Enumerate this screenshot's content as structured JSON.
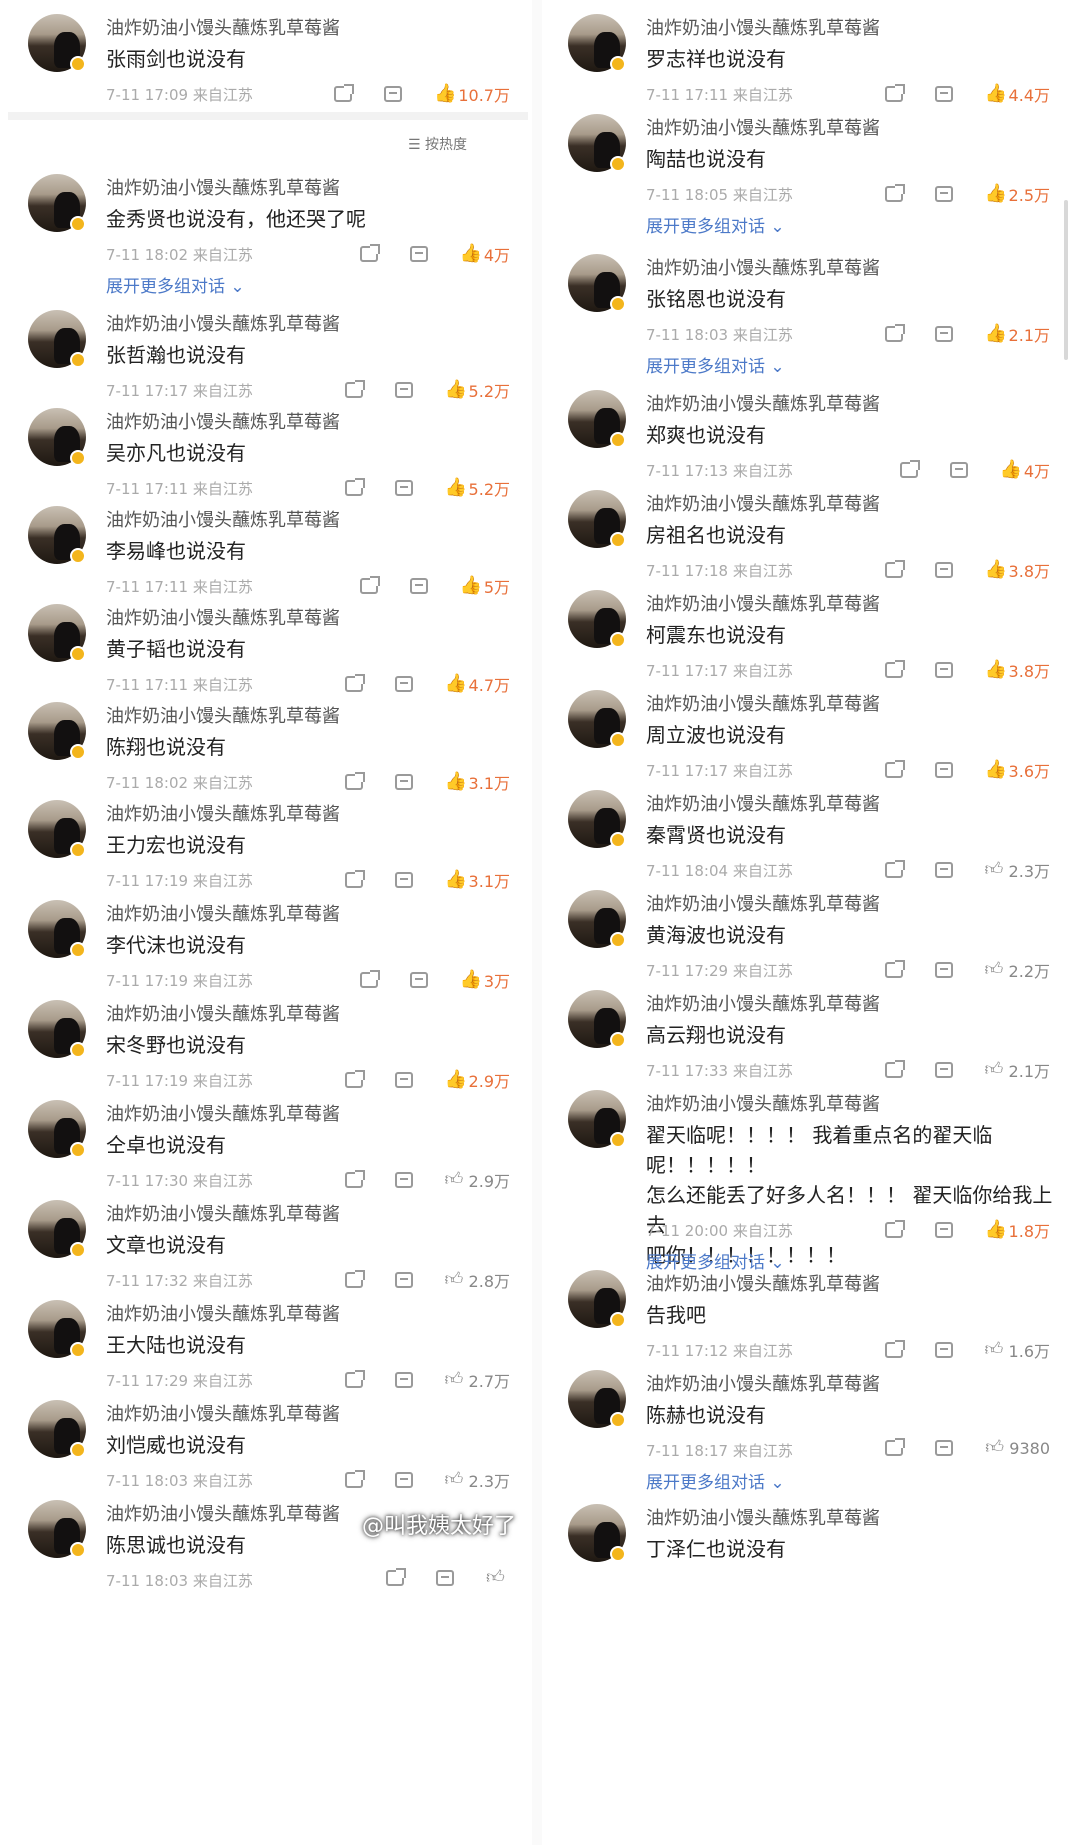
{
  "username": "油炸奶油小馒头蘸炼乳草莓酱",
  "sort_label": "按热度",
  "watermark": "@叫我姨太好了",
  "left": [
    {
      "text": "张雨剑也说没有",
      "time": "7-11 17:09",
      "loc": "来自江苏",
      "likes": "10.7万",
      "liked": true
    },
    {
      "text": "金秀贤也说没有，他还哭了呢",
      "time": "7-11 18:02",
      "loc": "来自江苏",
      "likes": "4万",
      "liked": true,
      "expand": "展开更多组对话"
    },
    {
      "text": "张哲瀚也说没有",
      "time": "7-11 17:17",
      "loc": "来自江苏",
      "likes": "5.2万",
      "liked": true
    },
    {
      "text": "吴亦凡也说没有",
      "time": "7-11 17:11",
      "loc": "来自江苏",
      "likes": "5.2万",
      "liked": true
    },
    {
      "text": "李易峰也说没有",
      "time": "7-11 17:11",
      "loc": "来自江苏",
      "likes": "5万",
      "liked": true
    },
    {
      "text": "黄子韬也说没有",
      "time": "7-11 17:11",
      "loc": "来自江苏",
      "likes": "4.7万",
      "liked": true
    },
    {
      "text": "陈翔也说没有",
      "time": "7-11 18:02",
      "loc": "来自江苏",
      "likes": "3.1万",
      "liked": true
    },
    {
      "text": "王力宏也说没有",
      "time": "7-11 17:19",
      "loc": "来自江苏",
      "likes": "3.1万",
      "liked": true
    },
    {
      "text": "李代沫也说没有",
      "time": "7-11 17:19",
      "loc": "来自江苏",
      "likes": "3万",
      "liked": true
    },
    {
      "text": "宋冬野也说没有",
      "time": "7-11 17:19",
      "loc": "来自江苏",
      "likes": "2.9万",
      "liked": true
    },
    {
      "text": "仝卓也说没有",
      "time": "7-11 17:30",
      "loc": "来自江苏",
      "likes": "2.9万",
      "liked": false
    },
    {
      "text": "文章也说没有",
      "time": "7-11 17:32",
      "loc": "来自江苏",
      "likes": "2.8万",
      "liked": false
    },
    {
      "text": "王大陆也说没有",
      "time": "7-11 17:29",
      "loc": "来自江苏",
      "likes": "2.7万",
      "liked": false
    },
    {
      "text": "刘恺威也说没有",
      "time": "7-11 18:03",
      "loc": "来自江苏",
      "likes": "2.3万",
      "liked": false
    },
    {
      "text": "陈思诚也说没有",
      "time": "7-11 18:03",
      "loc": "来自江苏",
      "likes": "",
      "liked": false
    }
  ],
  "right": [
    {
      "text": "罗志祥也说没有",
      "time": "7-11 17:11",
      "loc": "来自江苏",
      "likes": "4.4万",
      "liked": true
    },
    {
      "text": "陶喆也说没有",
      "time": "7-11 18:05",
      "loc": "来自江苏",
      "likes": "2.5万",
      "liked": true,
      "expand": "展开更多组对话"
    },
    {
      "text": "张铭恩也说没有",
      "time": "7-11 18:03",
      "loc": "来自江苏",
      "likes": "2.1万",
      "liked": true,
      "expand": "展开更多组对话"
    },
    {
      "text": "郑爽也说没有",
      "time": "7-11 17:13",
      "loc": "来自江苏",
      "likes": "4万",
      "liked": true
    },
    {
      "text": "房祖名也说没有",
      "time": "7-11 17:18",
      "loc": "来自江苏",
      "likes": "3.8万",
      "liked": true
    },
    {
      "text": "柯震东也说没有",
      "time": "7-11 17:17",
      "loc": "来自江苏",
      "likes": "3.8万",
      "liked": true
    },
    {
      "text": "周立波也说没有",
      "time": "7-11 17:17",
      "loc": "来自江苏",
      "likes": "3.6万",
      "liked": true
    },
    {
      "text": "秦霄贤也说没有",
      "time": "7-11 18:04",
      "loc": "来自江苏",
      "likes": "2.3万",
      "liked": false
    },
    {
      "text": "黄海波也说没有",
      "time": "7-11 17:29",
      "loc": "来自江苏",
      "likes": "2.2万",
      "liked": false
    },
    {
      "text": "高云翔也说没有",
      "time": "7-11 17:33",
      "loc": "来自江苏",
      "likes": "2.1万",
      "liked": false
    },
    {
      "text": "翟天临呢！！！！ 我着重点名的翟天临呢！！！！！\n怎么还能丢了好多人名！！！ 翟天临你给我上去\n吧你！！！！！！！！",
      "time": "7-11 20:00",
      "loc": "来自江苏",
      "likes": "1.8万",
      "liked": true,
      "expand": "展开更多组对话"
    },
    {
      "text": "告我吧",
      "time": "7-11 17:12",
      "loc": "来自江苏",
      "likes": "1.6万",
      "liked": false
    },
    {
      "text": "陈赫也说没有",
      "time": "7-11 18:17",
      "loc": "来自江苏",
      "likes": "9380",
      "liked": false,
      "expand": "展开更多组对话"
    },
    {
      "text": "丁泽仁也说没有",
      "time": "",
      "loc": "",
      "likes": "",
      "liked": false
    }
  ]
}
